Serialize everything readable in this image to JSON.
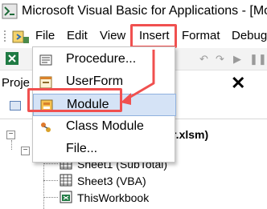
{
  "window": {
    "title": "Microsoft Visual Basic for Applications - [Mod"
  },
  "menu": {
    "file": "File",
    "edit": "Edit",
    "view": "View",
    "insert": "Insert",
    "format": "Format",
    "debug": "Debug"
  },
  "insert_menu": {
    "items": [
      {
        "label": "Procedure...",
        "icon": "procedure-icon"
      },
      {
        "label": "UserForm",
        "icon": "userform-icon"
      },
      {
        "label": "Module",
        "icon": "module-icon",
        "selected": true
      },
      {
        "label": "Class Module",
        "icon": "class-module-icon"
      },
      {
        "label": "File...",
        "icon": ""
      }
    ]
  },
  "project": {
    "header": "Proje",
    "close": "✕",
    "workbook_suffix": "r.xlsm)",
    "items": [
      {
        "label": "Sheet1 (SubTotal)"
      },
      {
        "label": "Sheet3 (VBA)"
      },
      {
        "label": "ThisWorkbook"
      }
    ]
  },
  "colors": {
    "annotation": "#f0504f",
    "selection_bg": "#d5e3f6",
    "selection_border": "#8fb1de"
  }
}
